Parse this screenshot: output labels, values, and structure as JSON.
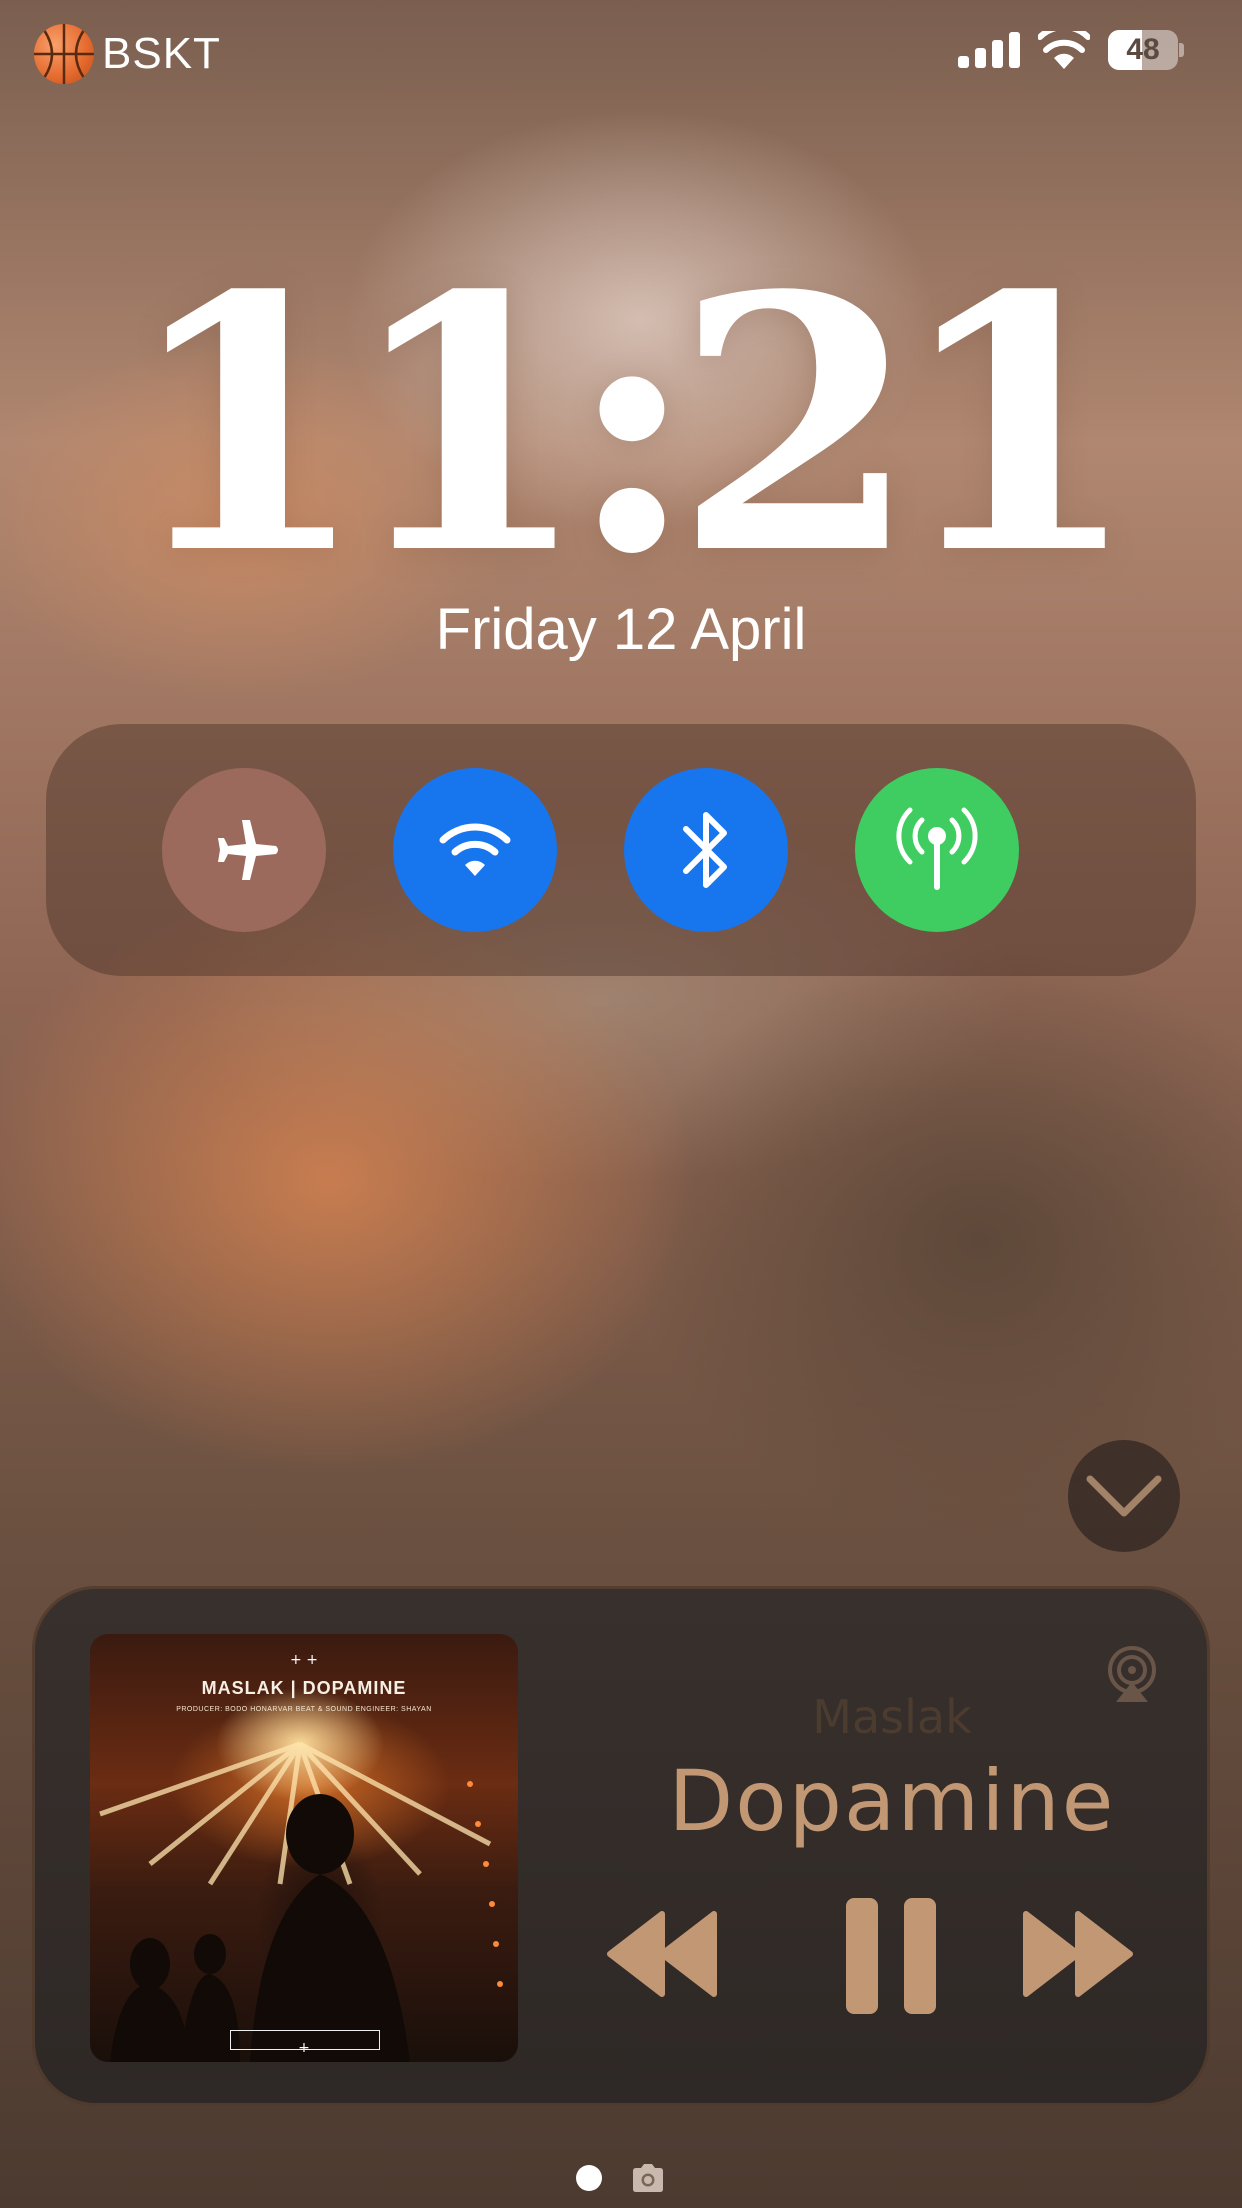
{
  "status_bar": {
    "carrier": "BSKT",
    "carrier_icon": "basketball-icon",
    "battery_percent": "48",
    "battery_level": 0.48,
    "signal_icon": "cellular-signal-icon",
    "wifi_icon": "wifi-icon"
  },
  "lock_screen": {
    "time": "11:21",
    "date": "Friday 12 April"
  },
  "toggles": [
    {
      "name": "airplane-mode",
      "icon": "airplane-icon",
      "color": "#9b6a5c",
      "on": false
    },
    {
      "name": "wifi",
      "icon": "wifi-icon",
      "color": "#1776ee",
      "on": true
    },
    {
      "name": "bluetooth",
      "icon": "bluetooth-icon",
      "color": "#1776ee",
      "on": true
    },
    {
      "name": "cellular-data",
      "icon": "antenna-icon",
      "color": "#3fcd61",
      "on": true
    }
  ],
  "now_playing": {
    "artist": "Maslak",
    "title": "Dopamine",
    "artwork": {
      "title": "MASLAK | DOPAMINE",
      "credits": "PRODUCER: BODO HONARVAR   BEAT & SOUND ENGINEER: SHAYAN"
    },
    "airplay_icon": "airplay-icon",
    "rewind_icon": "rewind-icon",
    "pause_icon": "pause-icon",
    "forward_icon": "fast-forward-icon",
    "accent_color": "#c29773"
  },
  "pager": {
    "pages_icon": "page-dot-icon",
    "camera_icon": "camera-icon"
  }
}
